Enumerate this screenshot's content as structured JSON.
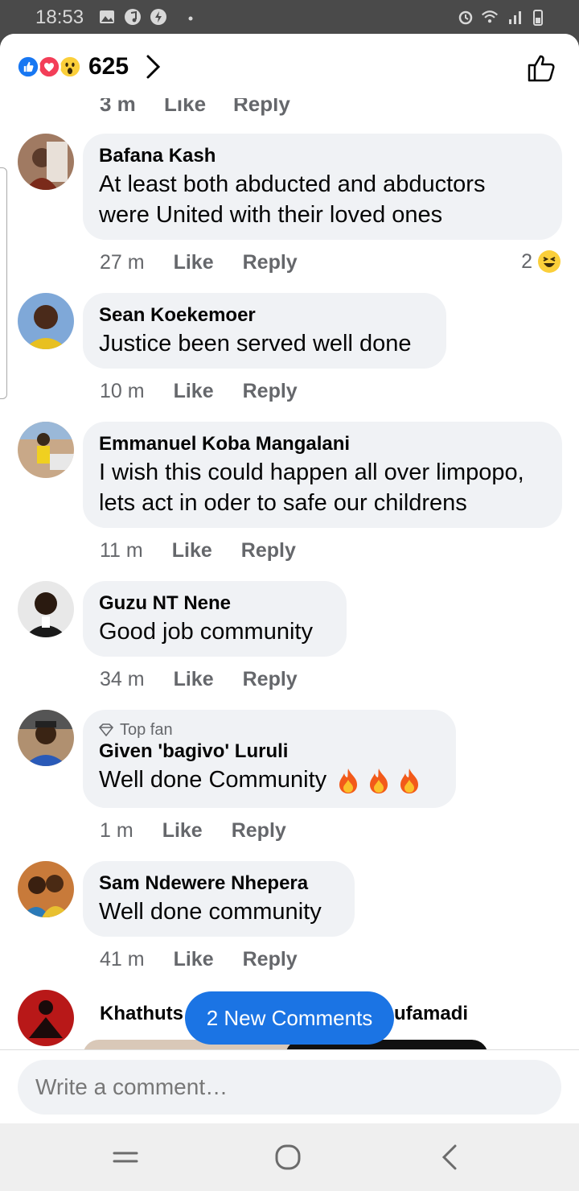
{
  "status_bar": {
    "time": "18:53"
  },
  "header": {
    "reaction_count": "625",
    "reaction_icons": [
      "like-icon",
      "love-icon",
      "wow-icon"
    ]
  },
  "cut_meta": {
    "time": "3 m",
    "like": "Like",
    "reply": "Reply"
  },
  "comments": [
    {
      "author": "Bafana Kash",
      "text_lines": [
        "At least both abducted and abductors",
        "were United with their loved ones"
      ],
      "time": "27 m",
      "like": "Like",
      "reply": "Reply",
      "reaction_count": "2"
    },
    {
      "author": "Sean Koekemoer",
      "text_lines": [
        "Justice been served well done"
      ],
      "time": "10 m",
      "like": "Like",
      "reply": "Reply"
    },
    {
      "author": "Emmanuel Koba Mangalani",
      "text_lines": [
        "I wish this could happen all over limpopo,",
        "lets act in oder to safe our childrens"
      ],
      "time": "11 m",
      "like": "Like",
      "reply": "Reply"
    },
    {
      "author": "Guzu NT Nene",
      "text_lines": [
        "Good job community"
      ],
      "time": "34 m",
      "like": "Like",
      "reply": "Reply"
    },
    {
      "badge": "Top fan",
      "author": "Given 'bagivo' Luruli",
      "text_lines": [
        "Well done Community"
      ],
      "time": "1 m",
      "like": "Like",
      "reply": "Reply"
    },
    {
      "author": "Sam Ndewere Nhepera",
      "text_lines": [
        "Well done community"
      ],
      "time": "41 m",
      "like": "Like",
      "reply": "Reply"
    },
    {
      "author_left": "Khathuts",
      "author_right": "ufamadi"
    }
  ],
  "new_comments_pill": "2 New Comments",
  "composer": {
    "placeholder": "Write a comment…"
  },
  "colors": {
    "accent": "#1b74e4",
    "bubble": "#f0f2f5",
    "meta": "#65676b"
  }
}
